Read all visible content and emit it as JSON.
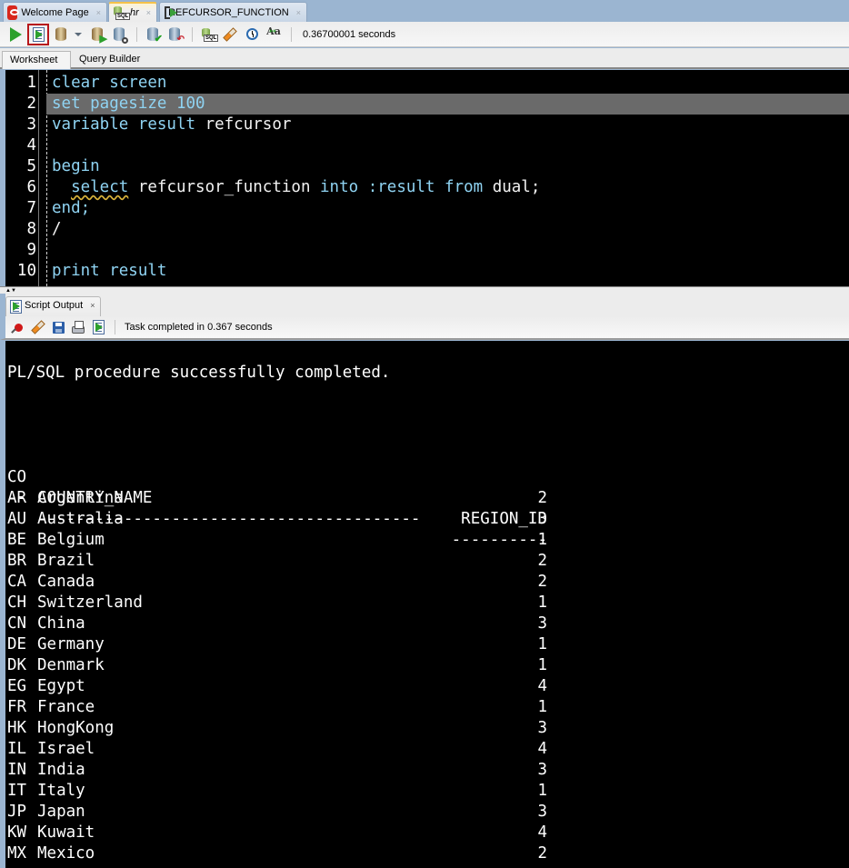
{
  "window_tabs": [
    {
      "label": "Welcome Page",
      "icon": "oracle-logo-icon",
      "active": false,
      "close": "×"
    },
    {
      "label": "hr",
      "icon": "sql-worksheet-icon",
      "active": true,
      "close": "×"
    },
    {
      "label": "REFCURSOR_FUNCTION",
      "icon": "function-icon",
      "active": false,
      "close": "×"
    }
  ],
  "toolbar": {
    "buttons": [
      {
        "name": "run-statement",
        "icon": "play-icon"
      },
      {
        "name": "run-script",
        "icon": "run-script-icon",
        "selected": true
      },
      {
        "name": "autotrace",
        "icon": "autotrace-icon"
      },
      {
        "name": "explain-plan",
        "icon": "explain-plan-icon"
      },
      {
        "name": "sql-tuning-advisor",
        "icon": "tuning-advisor-icon"
      },
      {
        "name": "commit",
        "icon": "commit-icon"
      },
      {
        "name": "rollback",
        "icon": "rollback-icon"
      },
      {
        "name": "unshared-sql-worksheet",
        "icon": "unshared-sql-icon"
      },
      {
        "name": "clear",
        "icon": "eraser-icon"
      },
      {
        "name": "sql-history",
        "icon": "history-icon"
      },
      {
        "name": "to-upper-lower",
        "icon": "case-icon"
      }
    ],
    "timing": "0.36700001 seconds"
  },
  "worksheet_tabs": [
    {
      "label": "Worksheet",
      "active": true
    },
    {
      "label": "Query Builder",
      "active": false
    }
  ],
  "editor": {
    "highlighted_line": 2,
    "lines": [
      {
        "n": "1",
        "tokens": [
          {
            "t": "clear screen",
            "c": "kw"
          }
        ]
      },
      {
        "n": "2",
        "tokens": [
          {
            "t": "set pagesize 100",
            "c": "kw"
          }
        ]
      },
      {
        "n": "3",
        "tokens": [
          {
            "t": "variable result ",
            "c": "kw"
          },
          {
            "t": "refcursor",
            "c": "id"
          }
        ]
      },
      {
        "n": "4",
        "tokens": []
      },
      {
        "n": "5",
        "tokens": [
          {
            "t": "begin",
            "c": "kw"
          }
        ]
      },
      {
        "n": "6",
        "tokens": [
          {
            "t": "  ",
            "c": "id"
          },
          {
            "t": "select",
            "c": "kw squig"
          },
          {
            "t": " refcursor_function ",
            "c": "id"
          },
          {
            "t": "into",
            "c": "kw"
          },
          {
            "t": " :result ",
            "c": "kw"
          },
          {
            "t": "from",
            "c": "kw"
          },
          {
            "t": " dual;",
            "c": "id"
          }
        ]
      },
      {
        "n": "7",
        "tokens": [
          {
            "t": "end;",
            "c": "kw"
          }
        ]
      },
      {
        "n": "8",
        "tokens": [
          {
            "t": "/",
            "c": "id"
          }
        ]
      },
      {
        "n": "9",
        "tokens": []
      },
      {
        "n": "10",
        "tokens": [
          {
            "t": "print result",
            "c": "kw"
          }
        ]
      }
    ]
  },
  "output_panel": {
    "tab_label": "Script Output",
    "tab_close": "×",
    "toolbar_buttons": [
      {
        "name": "freeze-view",
        "icon": "pin-icon"
      },
      {
        "name": "clear-output",
        "icon": "eraser-icon"
      },
      {
        "name": "save-output",
        "icon": "save-icon"
      },
      {
        "name": "print-output",
        "icon": "print-icon"
      },
      {
        "name": "run-script-output",
        "icon": "run-script-icon"
      }
    ],
    "status": "Task completed in 0.367 seconds",
    "message": "PL/SQL procedure successfully completed.",
    "result": {
      "headers": {
        "code": "CO",
        "name": "COUNTRY_NAME",
        "region": "REGION_ID"
      },
      "underline": {
        "code": "--",
        "name": "----------------------------------------",
        "region": "----------"
      },
      "rows": [
        {
          "code": "AR",
          "name": "Argentina",
          "region": "2"
        },
        {
          "code": "AU",
          "name": "Australia",
          "region": "3"
        },
        {
          "code": "BE",
          "name": "Belgium",
          "region": "1"
        },
        {
          "code": "BR",
          "name": "Brazil",
          "region": "2"
        },
        {
          "code": "CA",
          "name": "Canada",
          "region": "2"
        },
        {
          "code": "CH",
          "name": "Switzerland",
          "region": "1"
        },
        {
          "code": "CN",
          "name": "China",
          "region": "3"
        },
        {
          "code": "DE",
          "name": "Germany",
          "region": "1"
        },
        {
          "code": "DK",
          "name": "Denmark",
          "region": "1"
        },
        {
          "code": "EG",
          "name": "Egypt",
          "region": "4"
        },
        {
          "code": "FR",
          "name": "France",
          "region": "1"
        },
        {
          "code": "HK",
          "name": "HongKong",
          "region": "3"
        },
        {
          "code": "IL",
          "name": "Israel",
          "region": "4"
        },
        {
          "code": "IN",
          "name": "India",
          "region": "3"
        },
        {
          "code": "IT",
          "name": "Italy",
          "region": "1"
        },
        {
          "code": "JP",
          "name": "Japan",
          "region": "3"
        },
        {
          "code": "KW",
          "name": "Kuwait",
          "region": "4"
        },
        {
          "code": "MX",
          "name": "Mexico",
          "region": "2"
        }
      ]
    }
  },
  "colors": {
    "keyword": "#8fd3f2",
    "identifier": "#f2f2f2",
    "editor_bg": "#000000",
    "current_line": "#6a6a6a",
    "frame": "#9bb5d1",
    "selected_button_border": "#b7171b"
  }
}
